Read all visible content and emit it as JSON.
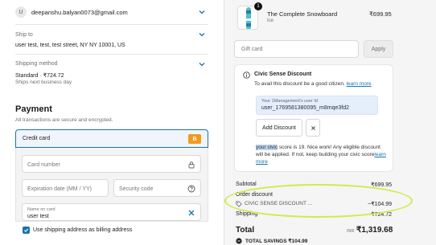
{
  "contact": {
    "avatar_initial": "U",
    "email": "deepanshu.balyan0073@gmail.com"
  },
  "ship_to": {
    "label": "Ship to",
    "value": "user test, test, test street, NY NY 10001, US"
  },
  "shipping_method": {
    "label": "Shipping method",
    "value": "Standard · ₹724.72",
    "sub": "Ships next business day"
  },
  "payment": {
    "heading": "Payment",
    "subtitle": "All transactions are secure and encrypted.",
    "method_label": "Credit card",
    "method_badge": "B",
    "card_number_placeholder": "Card number",
    "expiration_placeholder": "Expiration date (MM / YY)",
    "security_code_placeholder": "Security code",
    "name_on_card_label": "Name on card",
    "name_on_card_value": "user test",
    "billing_checkbox_label": "Use shipping address as billing address"
  },
  "product": {
    "quantity": "1",
    "name": "The Complete Snowboard",
    "variant": "Ice",
    "price": "₹699.95"
  },
  "gift_card": {
    "placeholder": "Gift card",
    "apply_label": "Apply"
  },
  "civic": {
    "title": "Civic Sense Discount",
    "desc_prefix": "To avail this discount be a good citizen. ",
    "learn_more": "learn more",
    "user_id_label": "Your 1Management's user Id",
    "user_id_value": "user_1769581380095_m8mqe3fd2",
    "add_discount_label": "Add Discount",
    "score_hl": "your civic",
    "score_rest": " score is 19. Nice work! Any eligible discount will be applied. If not, keep building your civic score",
    "score_learn_more": "learn more"
  },
  "summary": {
    "subtotal_label": "Subtotal",
    "subtotal_value": "₹699.95",
    "order_discount_label": "Order discount",
    "discount_code": "CIVIC SENSE DISCOUNT ...",
    "discount_value": "−₹104.99",
    "shipping_label": "Shipping",
    "shipping_value": "₹724.72",
    "total_label": "Total",
    "total_currency": "INR",
    "total_value": "₹1,319.68",
    "savings_label": "TOTAL SAVINGS",
    "savings_value": "₹104.99"
  },
  "colors": {
    "accent": "#1773b0",
    "highlight_ring": "#d4ea48",
    "card_badge": "#f29a1a"
  }
}
